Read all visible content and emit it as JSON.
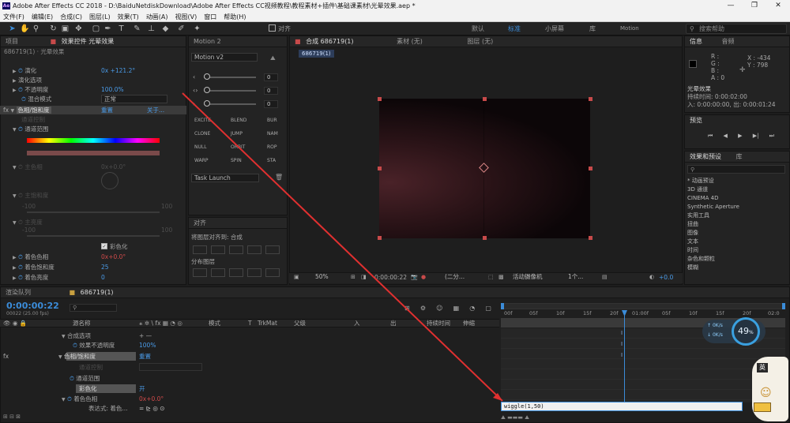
{
  "titlebar": {
    "title": "Adobe After Effects CC 2018 - D:\\BaiduNetdiskDownload\\Adobe After Effects CC视频教程\\教程素材+插件\\基础课素材\\光晕效果.aep *",
    "logo": "Ae"
  },
  "menu": [
    "文件(F)",
    "编辑(E)",
    "合成(C)",
    "图层(L)",
    "效果(T)",
    "动画(A)",
    "视图(V)",
    "窗口",
    "帮助(H)"
  ],
  "toolbar": {
    "align_label": "对齐",
    "workspaces": [
      "默认",
      "标准",
      "小屏幕",
      "库",
      "Motion"
    ],
    "search_placeholder": "搜索帮助"
  },
  "project_panel": {
    "tab_project": "项目",
    "tab_effects": "效果控件 光晕效果",
    "layer_path": "686719(1) · 光晕效果"
  },
  "effects": {
    "evolution": "演化",
    "evolution_value": "0x +121.2°",
    "evolution_options": "演化选项",
    "opacity": "不透明度",
    "opacity_value": "100.0%",
    "blend_mode": "混合模式",
    "blend_value": "正常",
    "hue_sat": "色相/饱和度",
    "reset": "重置",
    "about": "关于...",
    "channel_control": "通道控制",
    "channel_range": "通道范围",
    "master_hue": "主色相",
    "master_hue_value": "0x+0.0°",
    "master_sat": "主饱和度",
    "master_sat_min": "-100",
    "master_sat_max": "100",
    "master_light": "主亮度",
    "master_light_min": "-100",
    "master_light_max": "100",
    "colorize": "彩色化",
    "colorize_hue": "着色色相",
    "colorize_hue_value": "0x+0.0°",
    "colorize_sat": "着色饱和度",
    "colorize_sat_value": "25",
    "colorize_light": "着色亮度",
    "colorize_light_value": "0"
  },
  "motion_panel": {
    "title": "Motion 2",
    "dropdown": "Motion v2",
    "slider_values": [
      "0",
      "0",
      "0"
    ],
    "buttons": [
      "EXCITE",
      "BLEND",
      "BUR",
      "CLONE",
      "JUMP",
      "NAM",
      "NULL",
      "ORBIT",
      "ROP",
      "WARP",
      "SPIN",
      "STA"
    ],
    "task": "Task Launch"
  },
  "align_panel": {
    "title": "对齐",
    "align_to_label": "将图层对齐到:",
    "align_to_value": "合成",
    "distribute": "分布图层"
  },
  "comp_panel": {
    "tab_comp": "合成 686719(1)",
    "tab_material": "素材 (无)",
    "tab_layer": "图层 (无)",
    "comp_chip": "686719(1)",
    "zoom": "50%",
    "timecode": "0:00:00:22",
    "resolution": "(二分...",
    "camera": "活动摄像机",
    "views": "1个...",
    "exposure": "+0.0"
  },
  "info_panel": {
    "tab_info": "信息",
    "tab_audio": "音频",
    "r": "R :",
    "g": "G :",
    "b": "B :",
    "a": "A : 0",
    "x": "X : -434",
    "y": "Y : 798",
    "layer": "光晕效果",
    "duration": "持续时间: 0:00:02:00",
    "in_out": "入: 0:00:00:00, 出: 0:00:01:24"
  },
  "preview_panel": {
    "title": "预览"
  },
  "effects_presets": {
    "tab": "效果和预设",
    "tab_lib": "库",
    "items": [
      "* 动画预设",
      "3D 通道",
      "CINEMA 4D",
      "Synthetic Aperture",
      "实用工具",
      "扭曲",
      "图像",
      "文本",
      "时间",
      "杂色和颗粒",
      "模糊"
    ]
  },
  "timeline": {
    "tab_render": "渲染队列",
    "tab_comp": "686719(1)",
    "timecode": "0:00:00:22",
    "timecode_sub": "00022 (25.00 fps)",
    "columns": {
      "layer_name": "源名称",
      "mode": "模式",
      "t": "T",
      "trkmat": "TrkMat",
      "parent": "父级",
      "in": "入",
      "out": "出",
      "duration": "持续时间",
      "stretch": "伸缩"
    },
    "ruler": [
      "00f",
      "05f",
      "10f",
      "15f",
      "20f",
      "01:00f",
      "05f",
      "10f",
      "15f",
      "20f",
      "02:0"
    ],
    "rows": {
      "composite_options": "合成选项",
      "plus_minus": "+ —",
      "effect_opacity": "效果不透明度",
      "effect_opacity_value": "100%",
      "hue_sat": "色相/饱和度",
      "reset": "重置",
      "channel_control": "通道控制",
      "channel_range": "通道范围",
      "colorize": "彩色化",
      "colorize_value": "开",
      "colorize_hue": "着色色相",
      "colorize_hue_value": "0x+0.0°",
      "expression": "表达式: 着色..."
    },
    "expression_text": "wiggle(1,50)",
    "perf_value": "49",
    "perf_unit": "%",
    "perf_up": "0K/s",
    "perf_down": "0K/s"
  },
  "colors": {
    "accent": "#3b8cd9",
    "handle": "#c74a4a",
    "arrow": "#e03030"
  }
}
